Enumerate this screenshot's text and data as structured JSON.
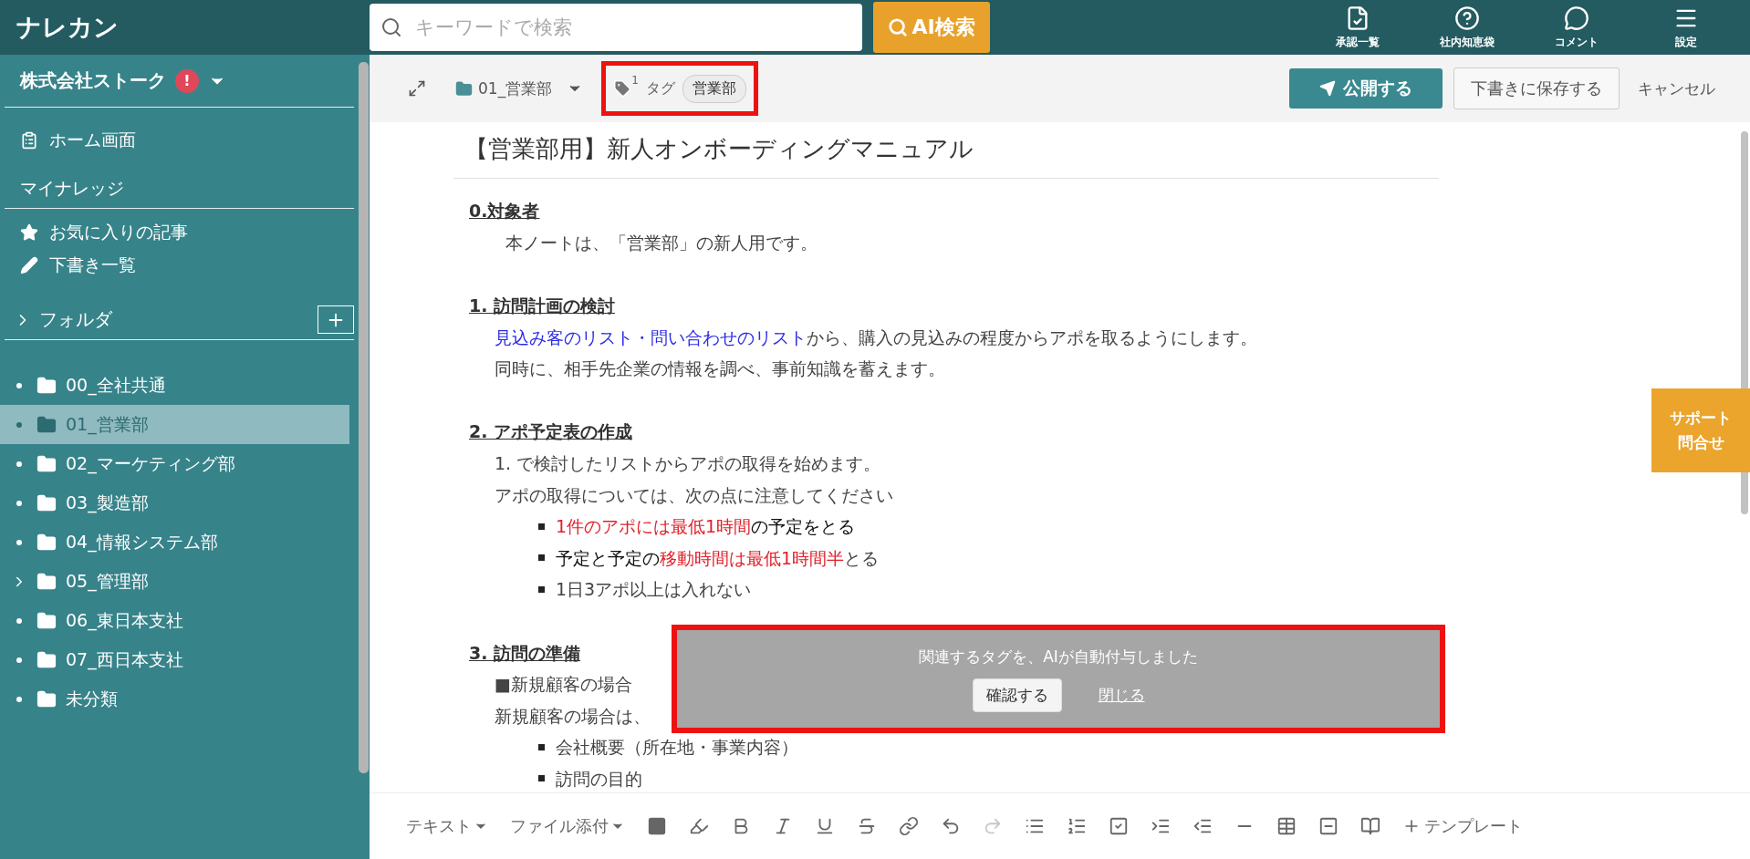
{
  "app": {
    "logo": "ナレカン"
  },
  "search": {
    "placeholder": "キーワードで検索",
    "button": "AI検索"
  },
  "top_nav": [
    {
      "kind": "approval",
      "label": "承認一覧"
    },
    {
      "kind": "question",
      "label": "社内知恵袋"
    },
    {
      "kind": "comment",
      "label": "コメント"
    },
    {
      "kind": "menu",
      "label": "設定"
    }
  ],
  "sidebar": {
    "company": "株式会社ストーク",
    "alert": "!",
    "home": "ホーム画面",
    "section": "マイナレッジ",
    "links": [
      {
        "kind": "star",
        "label": "お気に入りの記事"
      },
      {
        "kind": "pencil",
        "label": "下書き一覧"
      }
    ],
    "folder_header": "フォルダ",
    "folders": [
      {
        "label": "00_全社共通",
        "selected": false,
        "expandable": false
      },
      {
        "label": "01_営業部",
        "selected": true,
        "expandable": false
      },
      {
        "label": "02_マーケティング部",
        "selected": false,
        "expandable": false
      },
      {
        "label": "03_製造部",
        "selected": false,
        "expandable": false
      },
      {
        "label": "04_情報システム部",
        "selected": false,
        "expandable": false
      },
      {
        "label": "05_管理部",
        "selected": false,
        "expandable": true
      },
      {
        "label": "06_東日本支社",
        "selected": false,
        "expandable": false
      },
      {
        "label": "07_西日本支社",
        "selected": false,
        "expandable": false
      },
      {
        "label": "未分類",
        "selected": false,
        "expandable": false
      }
    ]
  },
  "editor_header": {
    "folder": "01_営業部",
    "tag_count": "1",
    "tag_label": "タグ",
    "tags": [
      "営業部"
    ],
    "highlighted": true,
    "publish": "公開する",
    "save_draft": "下書きに保存する",
    "cancel": "キャンセル"
  },
  "document": {
    "title": "【営業部用】新人オンボーディングマニュアル",
    "blocks": [
      {
        "kind": "heading",
        "parts": [
          {
            "text": "0.対象者"
          }
        ]
      },
      {
        "kind": "note",
        "parts": [
          {
            "text": "本ノートは、「営業部」の新人用です。"
          }
        ]
      },
      {
        "kind": "blank"
      },
      {
        "kind": "heading",
        "parts": [
          {
            "text": "1. 訪問計画の検討"
          }
        ]
      },
      {
        "kind": "para",
        "parts": [
          {
            "text": "見込み客のリスト・問い合わせのリスト",
            "color": "#2b2be6"
          },
          {
            "text": "から、購入の見込みの程度からアポを取るようにします。"
          }
        ]
      },
      {
        "kind": "para",
        "parts": [
          {
            "text": "同時に、相手先企業の情報を調べ、事前知識を蓄えます。"
          }
        ]
      },
      {
        "kind": "blank"
      },
      {
        "kind": "heading",
        "parts": [
          {
            "text": "2. アポ予定表の作成"
          }
        ]
      },
      {
        "kind": "para",
        "parts": [
          {
            "text": "1. で検討したリストからアポの取得を始めます。"
          }
        ]
      },
      {
        "kind": "para",
        "parts": [
          {
            "text": "アポの取得については、次の点に注意してください"
          }
        ]
      },
      {
        "kind": "bullet",
        "parts": [
          {
            "text": "1件のアポには最低1時間",
            "color": "#e0202a"
          },
          {
            "text": "の予定をとる",
            "color": "#111111"
          }
        ]
      },
      {
        "kind": "bullet",
        "parts": [
          {
            "text": "予定と予定の",
            "color": "#111111"
          },
          {
            "text": "移動時間は最低1時間半",
            "color": "#e0202a"
          },
          {
            "text": "とる"
          }
        ]
      },
      {
        "kind": "bullet",
        "parts": [
          {
            "text": "1日3アポ以上は入れない"
          }
        ]
      },
      {
        "kind": "blank"
      },
      {
        "kind": "heading",
        "parts": [
          {
            "text": "3. 訪問の準備"
          }
        ]
      },
      {
        "kind": "para",
        "parts": [
          {
            "text": "■新規顧客の場合"
          }
        ]
      },
      {
        "kind": "para",
        "parts": [
          {
            "text": "新規顧客の場合は、"
          }
        ]
      },
      {
        "kind": "bullet",
        "parts": [
          {
            "text": "会社概要（所在地・事業内容）"
          }
        ]
      },
      {
        "kind": "bullet",
        "parts": [
          {
            "text": "訪問の目的"
          }
        ]
      }
    ]
  },
  "toast": {
    "message": "関連するタグを、AIが自動付与しました",
    "confirm": "確認する",
    "close": "閉じる",
    "highlighted": true
  },
  "support": {
    "lines": [
      "サポート",
      "問合せ"
    ]
  },
  "toolbar": {
    "menus": [
      "テキスト",
      "ファイル添付"
    ],
    "tools": [
      {
        "kind": "color",
        "disabled": false
      },
      {
        "kind": "highlight",
        "disabled": false
      },
      {
        "kind": "bold",
        "disabled": false
      },
      {
        "kind": "italic",
        "disabled": false
      },
      {
        "kind": "underline",
        "disabled": false
      },
      {
        "kind": "strike",
        "disabled": false
      },
      {
        "kind": "link",
        "disabled": false
      },
      {
        "kind": "undo",
        "disabled": false
      },
      {
        "kind": "redo",
        "disabled": true
      },
      {
        "kind": "bullets",
        "disabled": false
      },
      {
        "kind": "numbers",
        "disabled": false
      },
      {
        "kind": "checklist",
        "disabled": false
      },
      {
        "kind": "indent",
        "disabled": false
      },
      {
        "kind": "outdent",
        "disabled": false
      },
      {
        "kind": "rule",
        "disabled": false
      },
      {
        "kind": "table",
        "disabled": false
      },
      {
        "kind": "minus",
        "disabled": false
      },
      {
        "kind": "book",
        "disabled": false
      }
    ],
    "template": "テンプレート"
  }
}
